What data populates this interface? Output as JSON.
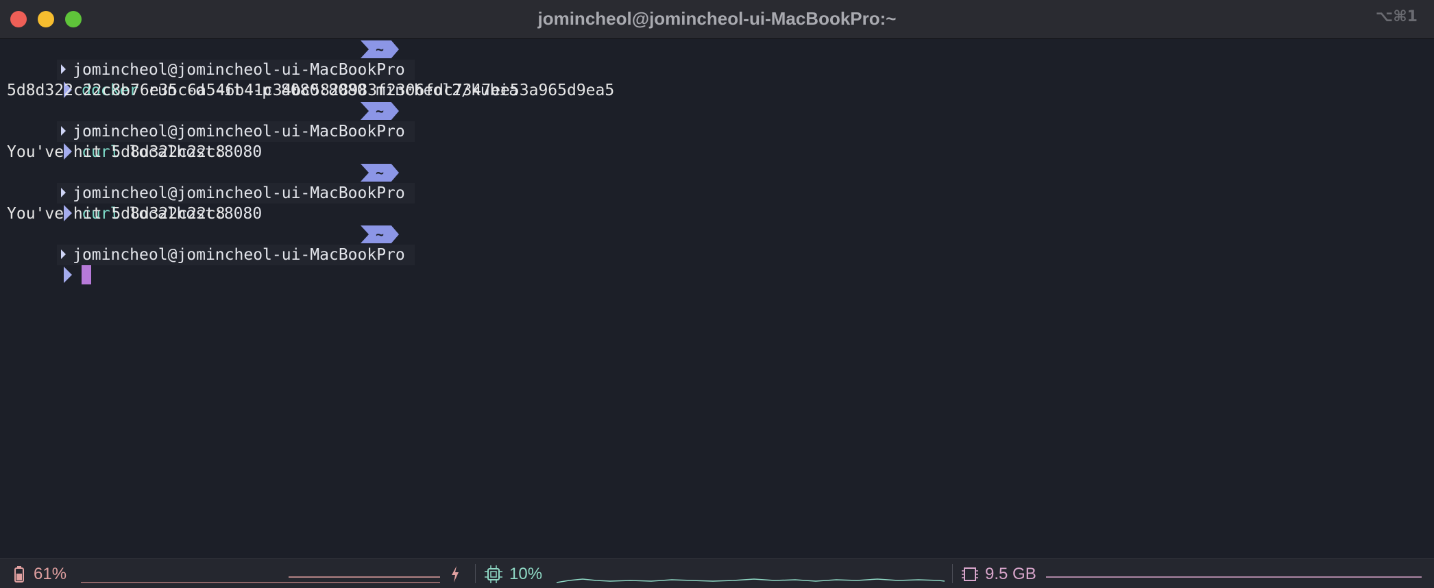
{
  "window": {
    "title": "jomincheol@jomincheol-ui-MacBookPro:~",
    "shortcut": "⌥⌘1"
  },
  "terminal": {
    "prompt_context": "jomincheol@jomincheol-ui-MacBookPro",
    "prompt_dir": "~",
    "entries": [
      {
        "command": "docker",
        "args": "run -d -it -p 8080:8080 mincheol2/kubia",
        "output": "5d8d322c22c8b76e35c6a546b41c34bc5828983f2306fdc7347ee53a965d9ea5"
      },
      {
        "command": "curl",
        "args": "localhost:8080",
        "output": "You've hit 5d8d322c22c8"
      },
      {
        "command": "curl",
        "args": "localhost:8080",
        "output": "You've hit 5d8d322c22c8"
      }
    ]
  },
  "statusbar": {
    "battery": {
      "icon": "battery-icon",
      "value": "61%",
      "color": "#e0a0a0",
      "fraction": 0.61
    },
    "charging": {
      "icon": "lightning-icon",
      "color": "#e0a0a0"
    },
    "cpu": {
      "icon": "cpu-icon",
      "value": "10%",
      "color": "#8fd9c5",
      "fraction": 0.1
    },
    "memory": {
      "icon": "memory-icon",
      "value": "9.5 GB",
      "color": "#d9a6cc"
    }
  },
  "colors": {
    "background": "#1c1f28",
    "command": "#7edbc9",
    "prompt_segment": "#8c96e6",
    "cursor": "#b77ad9"
  }
}
